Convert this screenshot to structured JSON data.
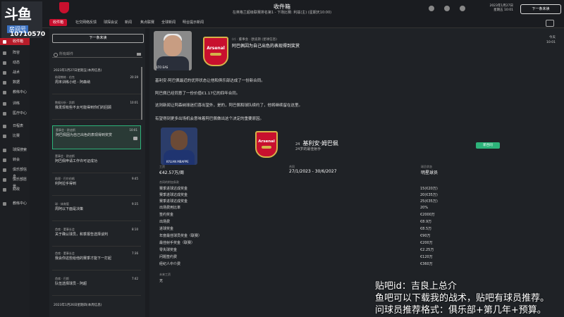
{
  "stream": {
    "logo_text": "斗鱼",
    "logo_badge": "房间号",
    "room_id": "10710570"
  },
  "header": {
    "title": "收件箱",
    "subtitle": "在英格兰超级联赛排名第1 - 下场比赛: 利兹(主) (星期天10:00)",
    "date_line1": "2023年1月27日",
    "date_line2": "星期五 10:01",
    "continue_label": "下一条未读"
  },
  "tabs": [
    "收件箱",
    "社交网络反馈",
    "球探会议",
    "新闻",
    "焦点联赛",
    "全球新闻",
    "明合提示新闻"
  ],
  "sidebar": [
    {
      "label": "收件箱",
      "active": true
    },
    {
      "label": "阵容"
    },
    {
      "label": "动态"
    },
    {
      "label": "战术"
    },
    {
      "label": "数据"
    },
    {
      "label": "教练中心"
    },
    {
      "label": "训练"
    },
    {
      "label": "医疗中心"
    },
    {
      "label": "日程表"
    },
    {
      "label": "比赛"
    },
    {
      "label": "球探搜索"
    },
    {
      "label": "转会"
    },
    {
      "label": "俱乐部信息"
    },
    {
      "label": "俱乐部愿景"
    },
    {
      "label": "财政"
    },
    {
      "label": "教练中心"
    }
  ],
  "inbox": {
    "new_msg_label": "下一条未读",
    "search_placeholder": "所有邮件",
    "date_header_1": "2023年1月27日星期五(本周信息)",
    "date_header_2": "2023年1月26日星期四(本周信息)",
    "messages": [
      {
        "from": "助理教练 · 伯克",
        "subject": "周末训练小结 - 阿森纳",
        "time": "20:39"
      },
      {
        "from": "数据分析 · 凯斯",
        "subject": "我发现有些不太可能得到你们的回顾",
        "time": "10:01"
      },
      {
        "from": "董事会 · 欧迪斯",
        "subject": "阿巴佩因为自己出色的表现得到奖赏",
        "time": "10:01",
        "selected": true
      },
      {
        "from": "董事会 · 欧迪斯",
        "subject": "阿巴佩申请工作许可证成功",
        "time": ""
      },
      {
        "from": "助理 · 巴尔伯格",
        "subject": "利阿拉手得到",
        "time": "9:45"
      },
      {
        "from": "球 · 体育管",
        "subject": "周阿以下面是决策",
        "time": "9:35"
      },
      {
        "from": "首席 · 董事长会",
        "subject": "关于确认球员，和季报告选择谈判",
        "time": "8:10"
      },
      {
        "from": "首席 · 董事长会",
        "subject": "我会你这些给他的赛季才能下一打起",
        "time": "7:36"
      },
      {
        "from": "首席 · 巴斯",
        "subject": "队伍选择球员 - 阿超",
        "time": "7:42"
      }
    ]
  },
  "message": {
    "from_line": "(r) · 董事会 · 欧迪斯 (星球信息)",
    "title": "阿巴佩因为自己出色的表现得到奖赏",
    "time_line1": "今天",
    "time_line2": "10:01",
    "photo_caption": "LTO EAS",
    "paragraphs": [
      "基利安·阿巴佩最近的优异状态让他和俱乐部达成了一份新合同。",
      "阿巴佩已经同意了一份价值€1.17亿的四年合同。",
      "这则新闻让阿森纳球迷们喜出望外，是的，阿巴佩和球队续约了，他将继续留在这里。",
      "有望得到更多出场机会意味着阿巴佩做出这个决定的重要原因。"
    ],
    "player": {
      "number": "24",
      "name": "基利安·姆巴佩",
      "sub": "24岁的最佳射手",
      "photo_caption": "KYLIAN MBAPPE",
      "badge": "新合同",
      "wage_label": "工资",
      "wage_value": "€42.57万/周",
      "contract_label": "合同",
      "contract_value": "27/1/2023 - 30/6/2027",
      "status_label": "球员状态",
      "status_value": "明星球员"
    },
    "clauses_header": "合同的附加条款",
    "clauses": [
      {
        "label": "赛季进球达成奖金",
        "value": "15(€20万)"
      },
      {
        "label": "赛季进球达成奖金",
        "value": "20(€35万)"
      },
      {
        "label": "赛季进球达成奖金",
        "value": "25(€35万)"
      },
      {
        "label": "出场费用比率",
        "value": "20%"
      },
      {
        "label": "签约奖金",
        "value": "€2000万"
      },
      {
        "label": "出场费",
        "value": "€8.9万"
      },
      {
        "label": "进球奖金",
        "value": "€8.5万"
      },
      {
        "label": "年度最佳球员奖金（联赛）",
        "value": "€90万"
      },
      {
        "label": "最佳射手奖金（联赛）",
        "value": "€200万"
      },
      {
        "label": "零失球奖金",
        "value": "€2.25万"
      },
      {
        "label": "问题签约费",
        "value": "€120万"
      },
      {
        "label": "经纪人中介费",
        "value": "€360万"
      }
    ],
    "footer_label": "未来工资",
    "footer_value": "无"
  },
  "overlay": {
    "line1": "贴吧id：吉良上总介",
    "line2": "鱼吧可以下载我的战术，贴吧有球员推荐。",
    "line3": "问球员推荐格式：俱乐部+第几年+预算。"
  },
  "colors": {
    "accent": "#c8102e",
    "green": "#2db37a"
  }
}
